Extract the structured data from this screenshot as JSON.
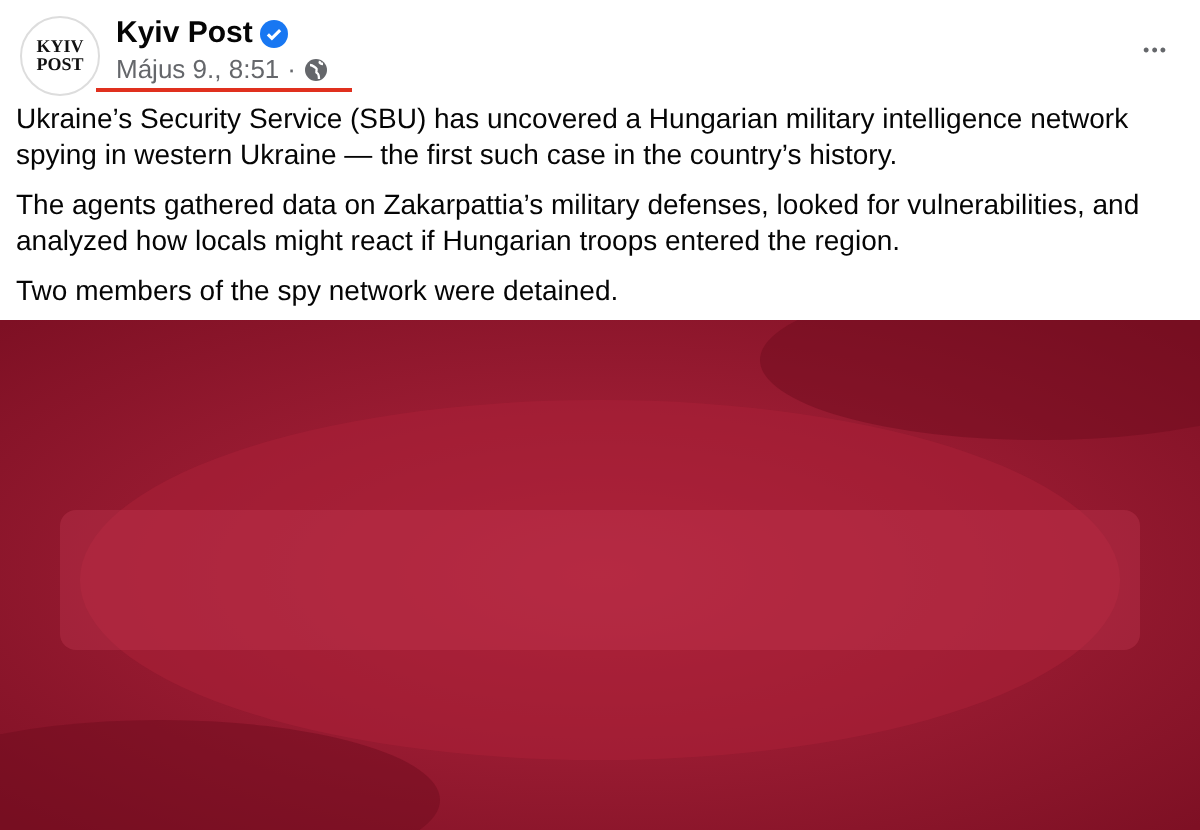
{
  "post": {
    "avatar_text": [
      "KYIV",
      "POST"
    ],
    "author": "Kyiv Post",
    "verified": true,
    "timestamp": "Május 9., 8:51",
    "separator": "·",
    "timestamp_underlined": true,
    "more": "•••",
    "paragraphs": [
      "Ukraine’s Security Service (SBU) has uncovered a Hungarian military intelligence network spying in western Ukraine — the first such case in the country’s history.",
      "The agents gathered data on Zakarpattia’s military defenses, looked for vulnerabilities, and analyzed how locals might react if Hungarian troops entered the region.",
      "Two members of the spy network were detained."
    ],
    "attachment": {
      "kind": "picture"
    }
  }
}
